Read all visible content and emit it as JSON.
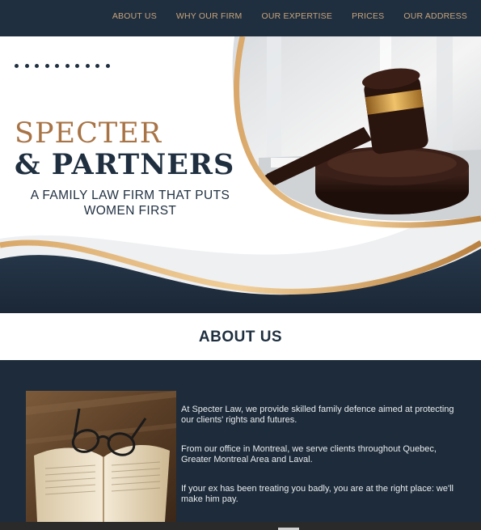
{
  "nav": {
    "items": [
      "ABOUT US",
      "WHY OUR FIRM",
      "OUR EXPERTISE",
      "PRICES",
      "OUR ADDRESS"
    ]
  },
  "hero": {
    "brand_line1": "SPECTER",
    "brand_line2": "& PARTNERS",
    "tagline_line1": "A FAMILY LAW FIRM THAT PUTS",
    "tagline_line2": "WOMEN FIRST",
    "image": "gavel-photo"
  },
  "about": {
    "title": "ABOUT US",
    "image": "open-book-with-glasses-photo",
    "paragraphs": [
      "At Specter Law, we provide skilled family defence aimed at protecting our clients' rights and futures.",
      "From our office in Montreal, we serve clients throughout Quebec, Greater Montreal Area and Laval.",
      "If your ex has been treating you badly, you are at the right place: we'll make him pay."
    ]
  },
  "colors": {
    "navy": "#1f2f40",
    "gold": "#c8a47a",
    "bronze": "#a87446",
    "white": "#ffffff"
  }
}
